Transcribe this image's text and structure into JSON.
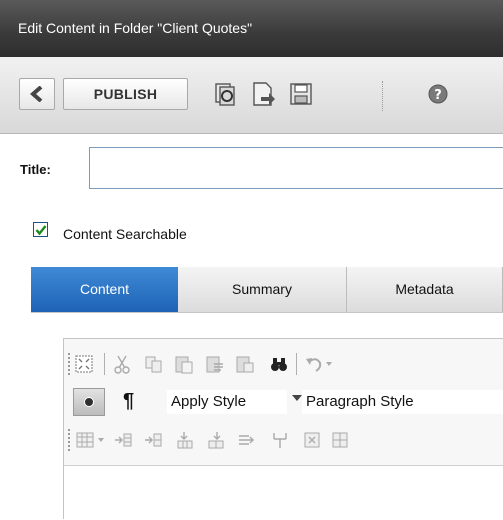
{
  "window": {
    "title": "Edit Content in Folder \"Client Quotes\""
  },
  "toolbar": {
    "back_icon": "chevron-left-icon",
    "publish_label": "PUBLISH",
    "icons": [
      "checkin-icon",
      "preview-icon",
      "save-icon",
      "help-icon"
    ]
  },
  "form": {
    "title_label": "Title:",
    "title_value": "",
    "content_searchable": {
      "label": "Content Searchable",
      "checked": true
    }
  },
  "tabs": [
    {
      "label": "Content",
      "active": true
    },
    {
      "label": "Summary",
      "active": false
    },
    {
      "label": "Metadata",
      "active": false
    }
  ],
  "editor": {
    "row1_icons": [
      "fullscreen-icon",
      "cut-icon",
      "copy-icon",
      "paste-icon",
      "paste-text-icon",
      "paste-word-icon",
      "find-icon",
      "undo-icon"
    ],
    "row2": {
      "apply_style": "Apply Style",
      "paragraph_style": "Paragraph Style",
      "pilcrow": "¶"
    },
    "row3_icons": [
      "table-icon",
      "insert-row-above-icon",
      "insert-row-below-icon",
      "insert-column-left-icon",
      "insert-column-right-icon",
      "merge-cells-icon",
      "split-cell-icon",
      "delete-cell-icon",
      "cell-props-icon"
    ]
  },
  "colors": {
    "accent": "#1e63b6",
    "titlebar": "#3a3a3a",
    "check": "#1a8a1a"
  }
}
